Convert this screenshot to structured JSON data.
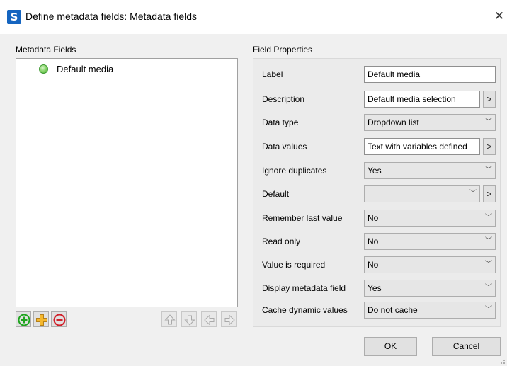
{
  "window": {
    "title": "Define metadata fields: Metadata fields",
    "app_icon": "S",
    "close_glyph": "✕"
  },
  "left": {
    "section_label": "Metadata Fields",
    "items": [
      {
        "label": "Default media",
        "icon": "green-circle-icon"
      }
    ]
  },
  "right": {
    "section_label": "Field Properties",
    "rows": [
      {
        "label": "Label",
        "value": "Default media"
      },
      {
        "label": "Description",
        "value": "Default media selection",
        "more": ">"
      },
      {
        "label": "Data type",
        "value": "Dropdown list"
      },
      {
        "label": "Data values",
        "value": "Text with variables defined",
        "more": ">"
      },
      {
        "label": "Ignore duplicates",
        "value": "Yes"
      },
      {
        "label": "Default",
        "value": "",
        "more": ">"
      },
      {
        "label": "Remember last value",
        "value": "No"
      },
      {
        "label": "Read only",
        "value": "No"
      },
      {
        "label": "Value is required",
        "value": "No"
      },
      {
        "label": "Display metadata field",
        "value": "Yes"
      },
      {
        "label": "Cache dynamic values",
        "value": "Do not cache"
      }
    ]
  },
  "buttons": {
    "ok": "OK",
    "cancel": "Cancel"
  },
  "colors": {
    "add": "#1fa51f",
    "remove": "#d0202a",
    "add_child": "#f5b82e"
  }
}
